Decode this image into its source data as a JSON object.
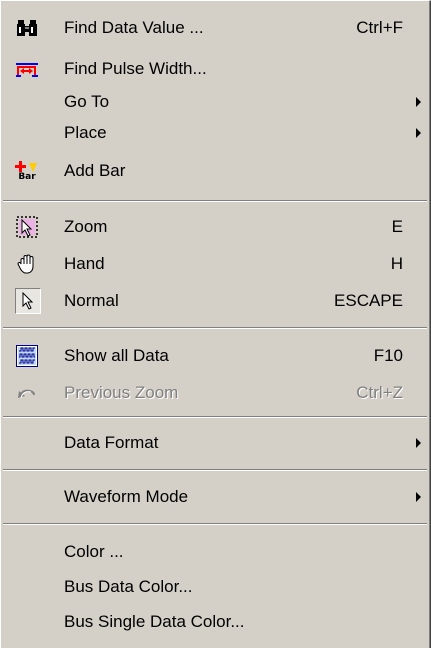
{
  "menu": {
    "items": {
      "find_data_value": {
        "label": "Find Data Value ...",
        "shortcut": "Ctrl+F",
        "icon": "binoculars-icon"
      },
      "find_pulse_width": {
        "label": "Find Pulse Width...",
        "icon": "pulse-width-icon"
      },
      "go_to": {
        "label": "Go To",
        "submenu": true
      },
      "place": {
        "label": "Place",
        "submenu": true
      },
      "add_bar": {
        "label": "Add Bar",
        "icon": "add-bar-icon",
        "icon_text": "Bar"
      },
      "zoom": {
        "label": "Zoom",
        "shortcut": "E",
        "icon": "zoom-cursor-icon"
      },
      "hand": {
        "label": "Hand",
        "shortcut": "H",
        "icon": "hand-icon"
      },
      "normal": {
        "label": "Normal",
        "shortcut": "ESCAPE",
        "icon": "arrow-cursor-icon",
        "checked": true
      },
      "show_all_data": {
        "label": "Show all Data",
        "shortcut": "F10",
        "icon": "waveform-icon"
      },
      "previous_zoom": {
        "label": "Previous Zoom",
        "shortcut": "Ctrl+Z",
        "icon": "undo-icon",
        "disabled": true
      },
      "data_format": {
        "label": "Data Format",
        "submenu": true
      },
      "waveform_mode": {
        "label": "Waveform Mode",
        "submenu": true
      },
      "color": {
        "label": "Color ..."
      },
      "bus_data_color": {
        "label": "Bus Data Color..."
      },
      "bus_single_data_color": {
        "label": "Bus Single Data Color..."
      }
    }
  },
  "colors": {
    "menu_background": "#d4d0c8",
    "disabled_text": "#808080",
    "pulse_icon_red": "#ff0000",
    "pulse_icon_blue": "#0000ff"
  }
}
